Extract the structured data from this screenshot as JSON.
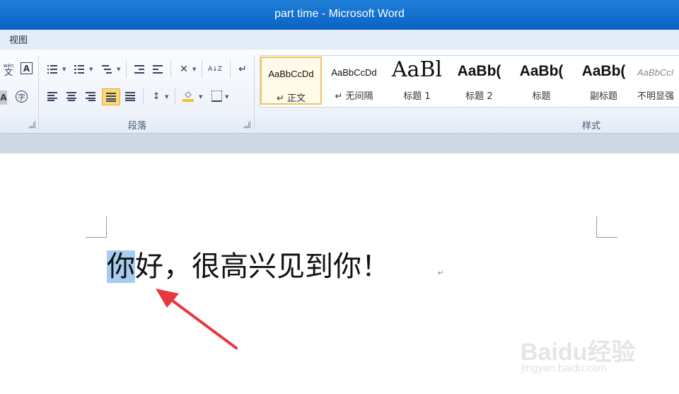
{
  "window": {
    "title": "part time - Microsoft Word"
  },
  "menu": {
    "view_label": "视图"
  },
  "ribbon": {
    "paragraph_group_label": "段落",
    "styles_group_label": "样式",
    "styles": [
      {
        "sample": "AaBbCcDd",
        "name": "↵ 正文"
      },
      {
        "sample": "AaBbCcDd",
        "name": "↵ 无间隔"
      },
      {
        "sample": "AaBl",
        "name": "标题 1"
      },
      {
        "sample": "AaBb(",
        "name": "标题 2"
      },
      {
        "sample": "AaBb(",
        "name": "标题"
      },
      {
        "sample": "AaBb(",
        "name": "副标题"
      },
      {
        "sample": "AaBbCcI",
        "name": "不明显强"
      }
    ],
    "icons": {
      "phonetic": "wén 文",
      "char_border": "A",
      "char_shading": "A",
      "enclose": "字",
      "sort": "A↓Z",
      "show_marks": "↵"
    }
  },
  "document": {
    "selected_char": "你",
    "rest_text": "好，很高兴见到你！",
    "para_mark": "↵"
  },
  "watermark": {
    "logo": "Baidu经验",
    "url": "jingyan.baidu.com"
  },
  "colors": {
    "title_bar": "#0a62c4",
    "selection": "#a6cdf0",
    "arrow": "#e8383d",
    "active_button": "#fcd978"
  }
}
